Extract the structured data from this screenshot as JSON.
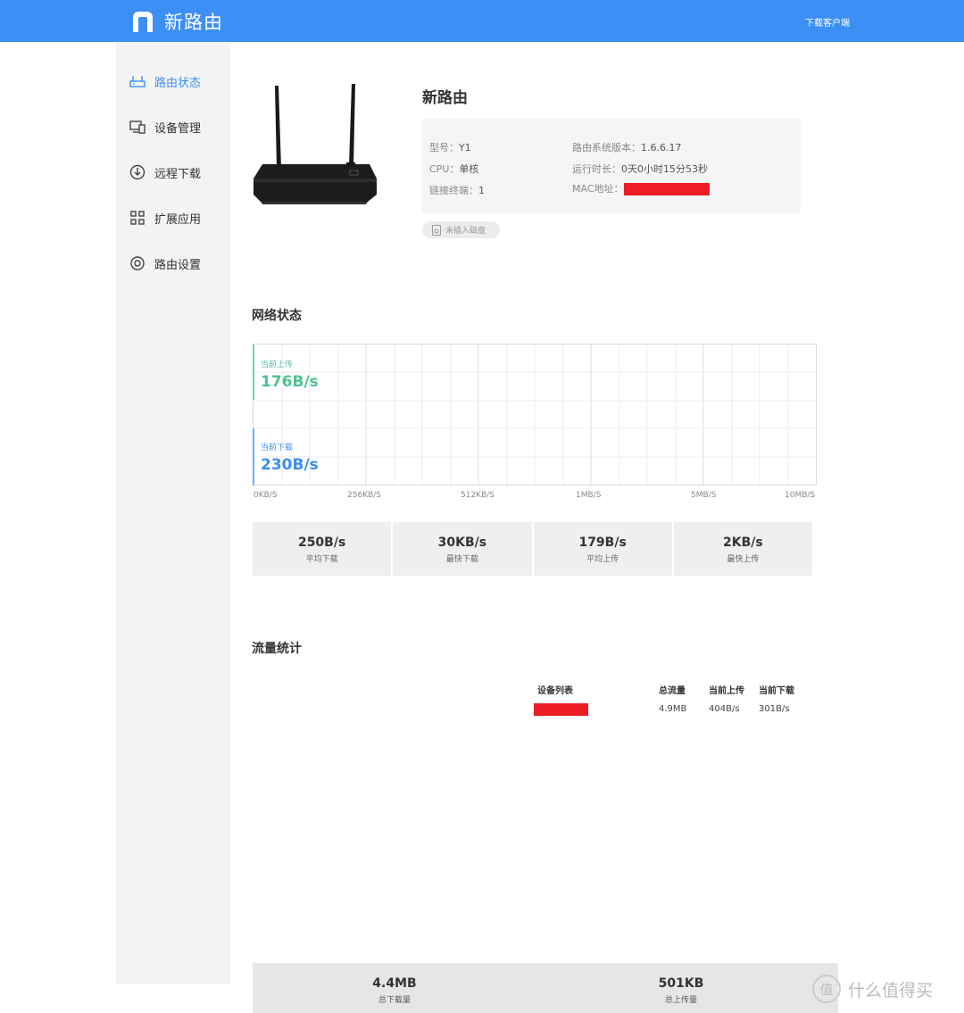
{
  "header": {
    "app_name": "新路由",
    "download_client": "下载客户端",
    "brand_color": "#3c8ff5"
  },
  "sidebar": {
    "items": [
      {
        "label": "路由状态",
        "icon": "router-icon",
        "active": true
      },
      {
        "label": "设备管理",
        "icon": "devices-icon",
        "active": false
      },
      {
        "label": "远程下载",
        "icon": "download-icon",
        "active": false
      },
      {
        "label": "扩展应用",
        "icon": "apps-grid-icon",
        "active": false
      },
      {
        "label": "路由设置",
        "icon": "settings-icon",
        "active": false
      }
    ]
  },
  "device": {
    "name": "新路由",
    "model_label": "型号：",
    "model_value": "Y1",
    "cpu_label": "CPU：",
    "cpu_value": "单核",
    "clients_label": "链接终端：",
    "clients_value": "1",
    "firmware_label": "路由系统版本：",
    "firmware_value": "1.6.6.17",
    "uptime_label": "运行时长：",
    "uptime_value": "0天0小时15分53秒",
    "mac_label": "MAC地址：",
    "disk_status": "未插入磁盘"
  },
  "network": {
    "title": "网络状态",
    "upload_caption": "当前上传",
    "upload_value": "176B/s",
    "download_caption": "当前下载",
    "download_value": "230B/s",
    "upload_color": "#4fc290",
    "download_color": "#3c8ff5",
    "axis_ticks": [
      "0KB/S",
      "256KB/S",
      "512KB/S",
      "1MB/S",
      "5MB/S",
      "10MB/S"
    ],
    "stats": [
      {
        "value": "250B/s",
        "caption": "平均下载"
      },
      {
        "value": "30KB/s",
        "caption": "最快下载"
      },
      {
        "value": "179B/s",
        "caption": "平均上传"
      },
      {
        "value": "2KB/s",
        "caption": "最快上传"
      }
    ]
  },
  "traffic": {
    "title": "流量统计",
    "columns": [
      "设备列表",
      "总流量",
      "当前上传",
      "当前下载"
    ],
    "rows": [
      {
        "total": "4.9MB",
        "upload": "404B/s",
        "download": "301B/s"
      }
    ],
    "totals": [
      {
        "value": "4.4MB",
        "caption": "总下载量"
      },
      {
        "value": "501KB",
        "caption": "总上传量"
      }
    ]
  },
  "watermark": {
    "glyph": "值",
    "text": "什么值得买"
  }
}
